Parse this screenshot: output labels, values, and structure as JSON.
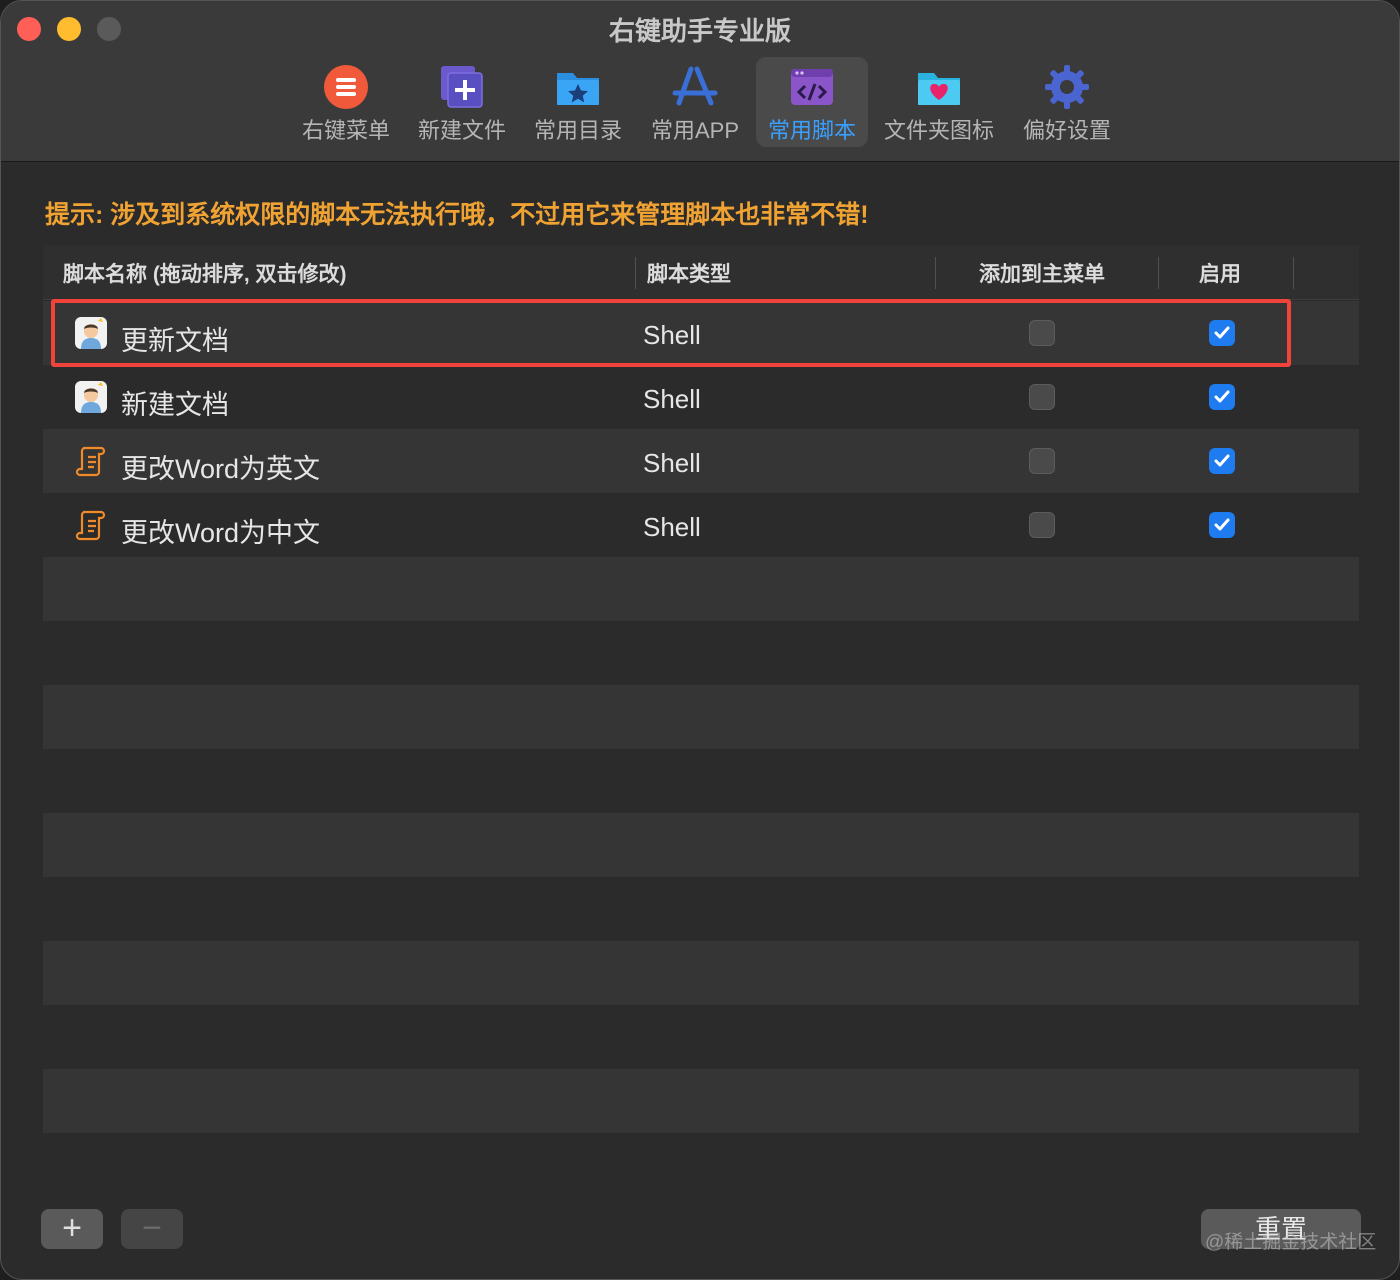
{
  "window": {
    "title": "右键助手专业版"
  },
  "toolbar": {
    "items": [
      {
        "label": "右键菜单",
        "icon": "menu-icon"
      },
      {
        "label": "新建文件",
        "icon": "new-file-icon"
      },
      {
        "label": "常用目录",
        "icon": "folder-star-icon"
      },
      {
        "label": "常用APP",
        "icon": "app-store-icon"
      },
      {
        "label": "常用脚本",
        "icon": "script-code-icon",
        "active": true
      },
      {
        "label": "文件夹图标",
        "icon": "folder-heart-icon"
      },
      {
        "label": "偏好设置",
        "icon": "gear-icon"
      }
    ]
  },
  "hint": "提示: 涉及到系统权限的脚本无法执行哦，不过用它来管理脚本也非常不错!",
  "table": {
    "headers": [
      "脚本名称 (拖动排序, 双击修改)",
      "脚本类型",
      "添加到主菜单",
      "启用"
    ],
    "rows": [
      {
        "name": "更新文档",
        "type": "Shell",
        "icon": "person-icon",
        "main_menu": false,
        "enabled": true,
        "selected": true
      },
      {
        "name": "新建文档",
        "type": "Shell",
        "icon": "person-icon",
        "main_menu": false,
        "enabled": true
      },
      {
        "name": "更改Word为英文",
        "type": "Shell",
        "icon": "scroll-icon",
        "main_menu": false,
        "enabled": true
      },
      {
        "name": "更改Word为中文",
        "type": "Shell",
        "icon": "scroll-icon",
        "main_menu": false,
        "enabled": true
      }
    ]
  },
  "footer": {
    "add_label": "+",
    "remove_label": "−",
    "reset_label": "重置",
    "watermark": "@稀土掘金技术社区"
  },
  "colors": {
    "accent": "#1e7bf0",
    "hint": "#f0a232",
    "highlight": "#f0443a"
  }
}
